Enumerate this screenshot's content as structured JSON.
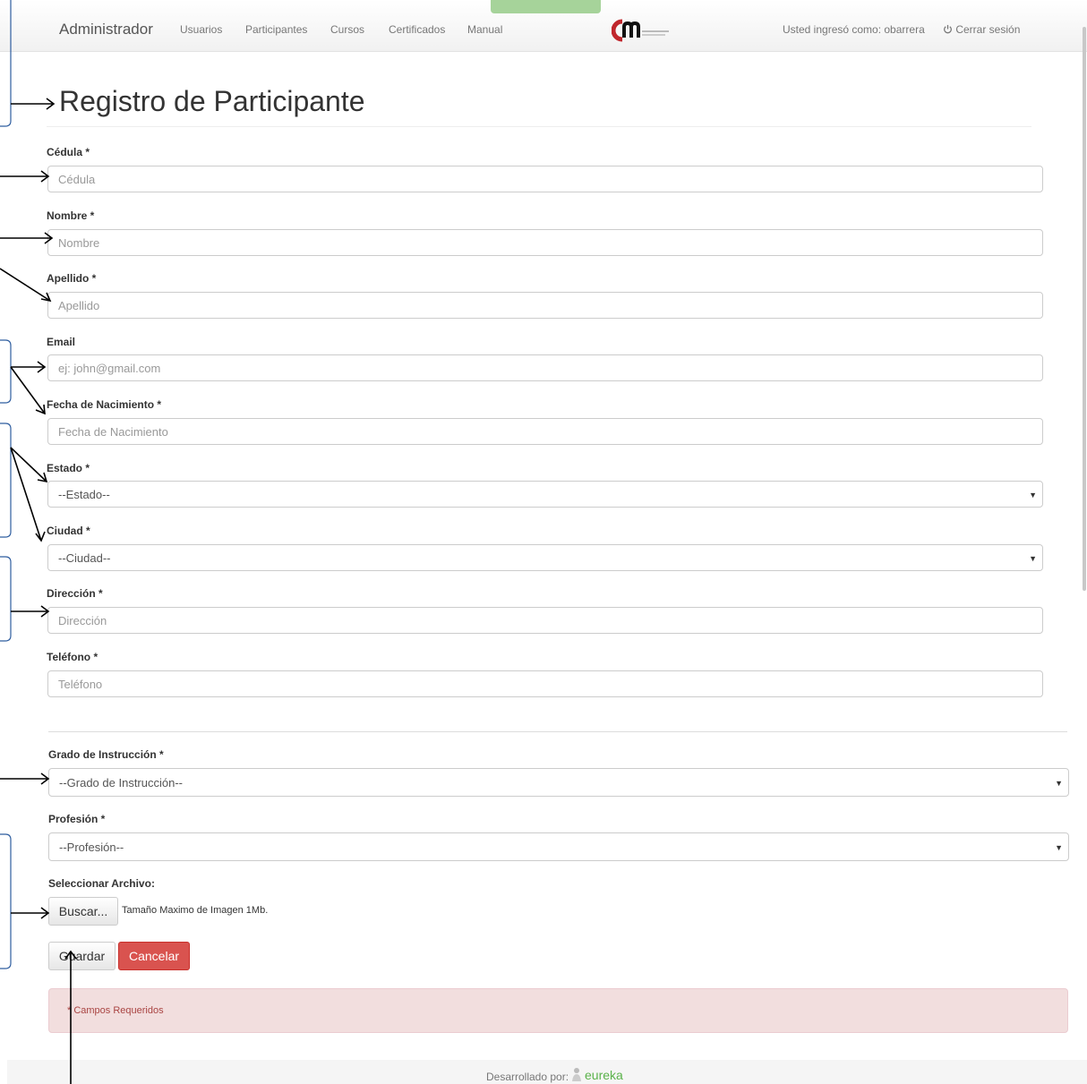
{
  "navbar": {
    "brand": "Administrador",
    "links": [
      "Usuarios",
      "Participantes",
      "Cursos",
      "Certificados",
      "Manual"
    ],
    "user_text": "Usted ingresó como: obarrera",
    "logout_label": "Cerrar sesión"
  },
  "page": {
    "title": "Registro de Participante"
  },
  "form": {
    "cedula": {
      "label": "Cédula *",
      "placeholder": "Cédula"
    },
    "nombre": {
      "label": "Nombre *",
      "placeholder": "Nombre"
    },
    "apellido": {
      "label": "Apellido *",
      "placeholder": "Apellido"
    },
    "email": {
      "label": "Email",
      "placeholder": "ej: john@gmail.com"
    },
    "fecha": {
      "label": "Fecha de Nacimiento *",
      "placeholder": "Fecha de Nacimiento"
    },
    "estado": {
      "label": "Estado *",
      "selected": "--Estado--"
    },
    "ciudad": {
      "label": "Ciudad *",
      "selected": "--Ciudad--"
    },
    "direccion": {
      "label": "Dirección *",
      "placeholder": "Dirección"
    },
    "telefono": {
      "label": "Teléfono *",
      "placeholder": "Teléfono"
    },
    "grado": {
      "label": "Grado de Instrucción *",
      "selected": "--Grado de Instrucción--"
    },
    "profesion": {
      "label": "Profesión *",
      "selected": "--Profesión--"
    },
    "archivo": {
      "label": "Seleccionar Archivo:",
      "button": "Buscar...",
      "hint": "Tamaño Maximo de Imagen 1Mb."
    }
  },
  "buttons": {
    "save": "Guardar",
    "cancel": "Cancelar"
  },
  "alert": {
    "text": "* Campos Requeridos"
  },
  "footer": {
    "text": "Desarrollado por:",
    "brand": "eureka"
  },
  "colors": {
    "danger": "#d9534f",
    "alert_bg": "#f2dede",
    "alert_text": "#a94442",
    "nav_tab": "#a6d39a",
    "footer_brand": "#5ab24a"
  }
}
